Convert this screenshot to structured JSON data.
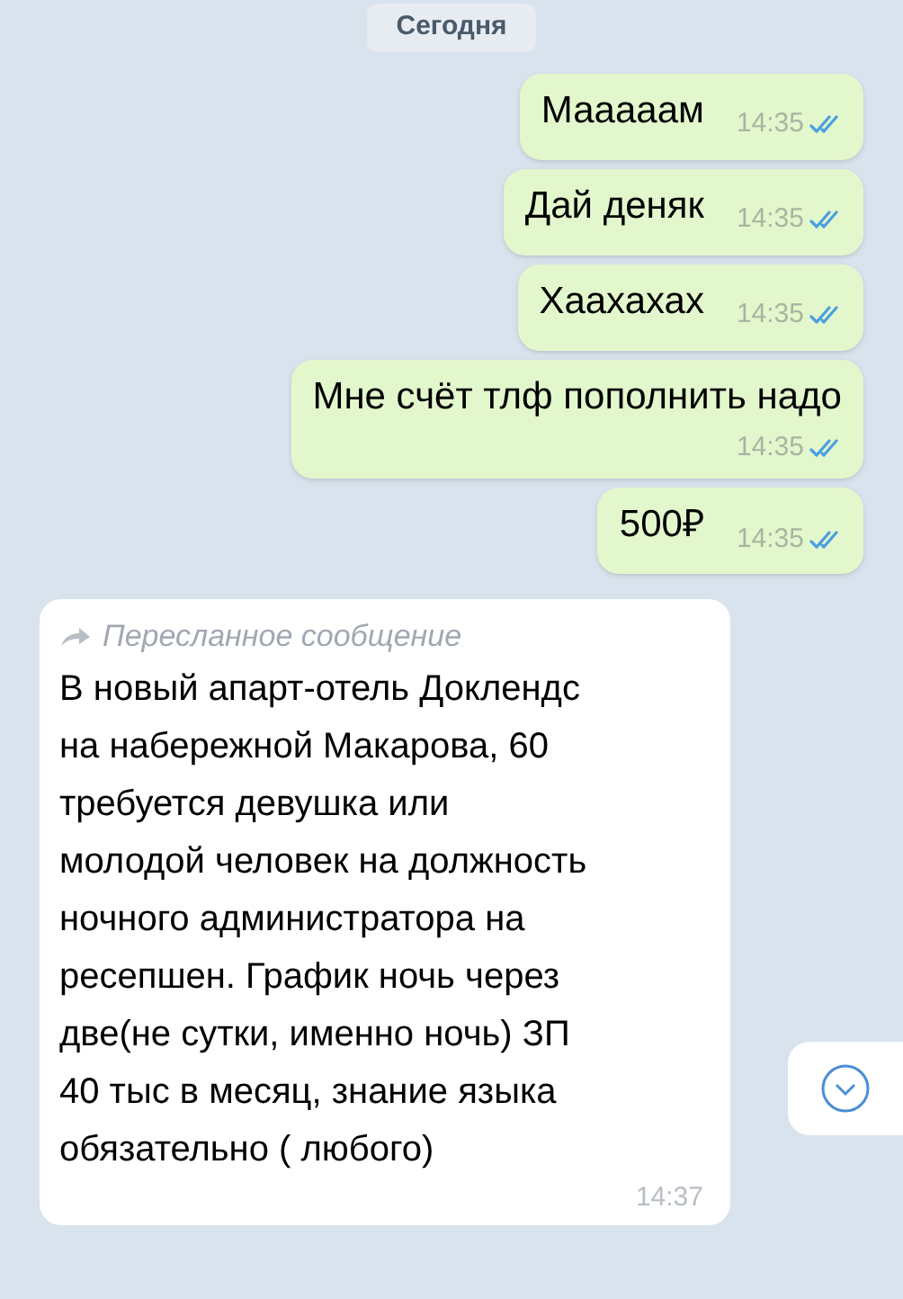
{
  "date_label": "Сегодня",
  "outgoing": [
    {
      "kind": "inline",
      "text": "Мааааам",
      "time": "14:35",
      "read": true
    },
    {
      "kind": "inline",
      "text": "Дай деняк",
      "time": "14:35",
      "read": true
    },
    {
      "kind": "inline",
      "text": "Хаахахах",
      "time": "14:35",
      "read": true
    },
    {
      "kind": "stacked",
      "text": "Мне счёт тлф пополнить надо",
      "time": "14:35",
      "read": true
    },
    {
      "kind": "inline",
      "text": "500₽",
      "time": "14:35",
      "read": true
    }
  ],
  "forwarded": {
    "label": "Пересланное сообщение",
    "text": "В новый апарт-отель Доклендс на набережной Макарова, 60 требуется девушка или молодой человек на должность ночного администратора на ресепшен. График ночь через две(не сутки, именно ночь) ЗП 40 тыс в месяц, знание языка обязательно ( любого)",
    "time": "14:37"
  }
}
